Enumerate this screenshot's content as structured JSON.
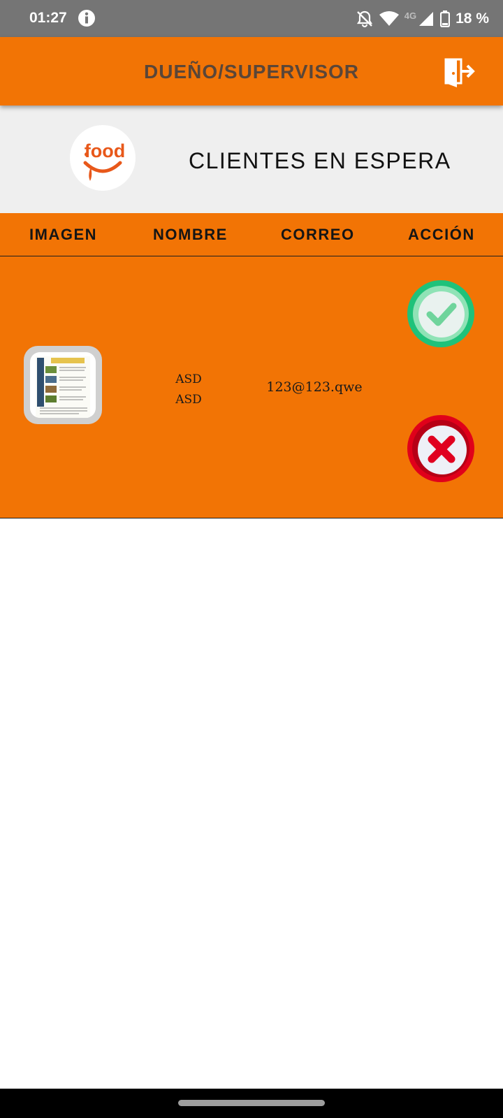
{
  "status_bar": {
    "time": "01:27",
    "network": "4G",
    "battery": "18 %",
    "icons": [
      "info-icon",
      "notifications-off-icon",
      "wifi-icon",
      "signal-icon",
      "battery-icon"
    ]
  },
  "app_bar": {
    "title": "DUEÑO/SUPERVISOR",
    "logout_icon": "logout-door-icon"
  },
  "header": {
    "logo_text": "food",
    "title": "CLIENTES EN ESPERA"
  },
  "table": {
    "columns": [
      "IMAGEN",
      "NOMBRE",
      "CORREO",
      "ACCIÓN"
    ],
    "rows": [
      {
        "name": "ASD\nASD",
        "name_first": "ASD",
        "name_last": "ASD",
        "email": "123@123.qwe"
      }
    ]
  },
  "colors": {
    "primary": "#f27405",
    "status_bar": "#757575",
    "accept": "#2ecc71",
    "reject": "#e0001a"
  }
}
